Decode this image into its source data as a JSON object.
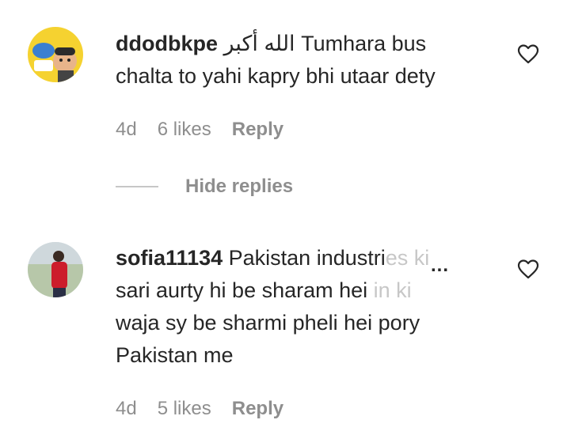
{
  "comments": [
    {
      "username": "ddodbkpe",
      "arabic": "الله أكبر",
      "text_line1": "Tumhara bus",
      "text_line2": "chalta to yahi kapry bhi utaar dety",
      "age": "4d",
      "likes": "6 likes",
      "reply": "Reply",
      "hide_replies": "Hide replies",
      "icon": "heart-icon"
    },
    {
      "username": "sofia11134",
      "line1_main": "Pakistan industri",
      "line1_faded": "es ki",
      "line2_main": "sari aurty hi be sharam hei ",
      "line2_faded": "in ki",
      "line3": "waja sy be sharmi pheli hei pory",
      "line4": "Pakistan me",
      "more": "...",
      "age": "4d",
      "likes": "5 likes",
      "reply": "Reply",
      "icon": "heart-icon"
    }
  ]
}
